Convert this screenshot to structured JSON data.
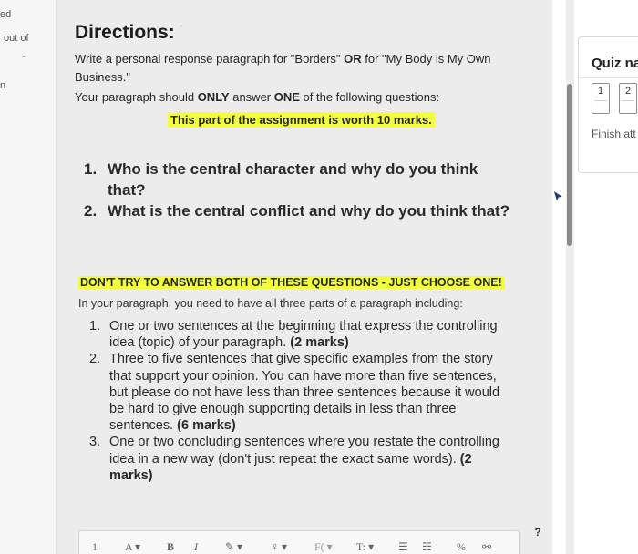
{
  "left_panel": {
    "fragment_ed": "ed",
    "fragment_out_of": "out of",
    "fragment_n": "n"
  },
  "question": {
    "title": "Directions:",
    "intro_prefix": "Write a personal response paragraph for \"Borders\" ",
    "intro_or": "OR",
    "intro_suffix": " for \"My Body is My Own Business.\"",
    "instruction_prefix": "Your paragraph should ",
    "instruction_only": "ONLY",
    "instruction_mid": " answer ",
    "instruction_one": "ONE",
    "instruction_suffix": " of the following questions:",
    "worth": "This part of the assignment is worth 10 marks.",
    "choices": [
      {
        "num": "1.",
        "text": "Who is the central character and why do you think that?"
      },
      {
        "num": "2.",
        "text": "What is the central conflict and why do you think that?"
      }
    ],
    "warning": "DON'T TRY TO ANSWER BOTH OF THESE QUESTIONS - JUST CHOOSE ONE!",
    "paragraph_intro": "In your paragraph, you need to have all three parts of a paragraph including:",
    "parts": [
      {
        "num": "1.",
        "text": "One or two sentences at the beginning that express the controlling idea (topic) of your paragraph. ",
        "marks": "(2 marks)"
      },
      {
        "num": "2.",
        "text": "Three to five sentences that give specific examples from the story that support your opinion. You can have more than five sentences, but please do not have less than three sentences because it would be hard to give enough supporting details in less than three sentences. ",
        "marks": "(6 marks)"
      },
      {
        "num": "3.",
        "text": "One or two concluding sentences where you restate the controlling idea in a new way (don't just repeat the exact same words). ",
        "marks": "(2 marks)"
      }
    ],
    "help": "?"
  },
  "toolbar": {
    "paragraph_icon": "1",
    "font_color": "A",
    "bold": "B",
    "italic": "I",
    "text_size": "T:",
    "format": "F("
  },
  "quiz_nav": {
    "title": "Quiz na",
    "items": [
      "1",
      "2"
    ],
    "finish": "Finish att"
  }
}
